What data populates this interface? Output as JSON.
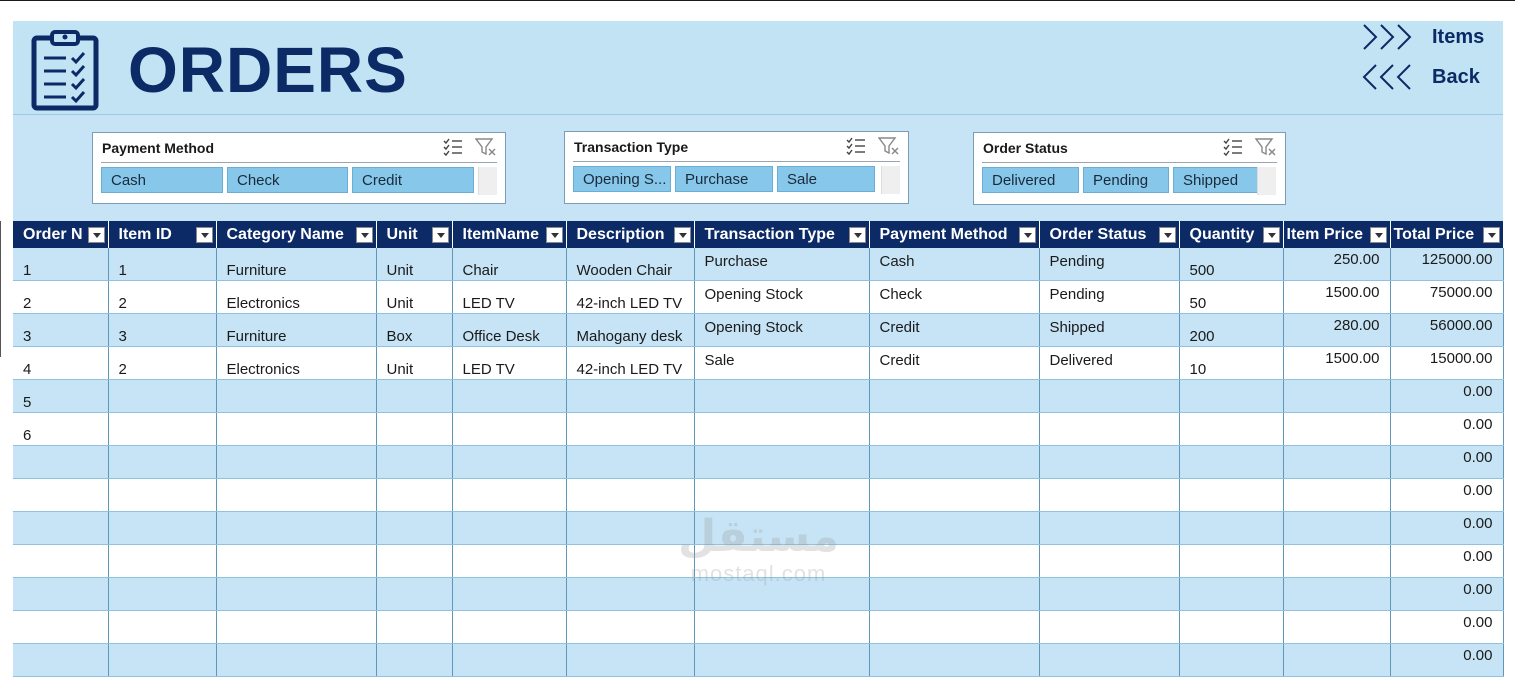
{
  "header": {
    "title": "ORDERS",
    "nav_items": "Items",
    "nav_back": "Back"
  },
  "colors": {
    "navy": "#0b2a66",
    "band_light": "#c6e4f5",
    "slicer_button": "#86c7ea"
  },
  "slicers": {
    "payment": {
      "title": "Payment Method",
      "buttons": [
        "Cash",
        "Check",
        "Credit"
      ]
    },
    "transaction": {
      "title": "Transaction Type",
      "buttons": [
        "Opening S...",
        "Purchase",
        "Sale"
      ]
    },
    "status": {
      "title": "Order Status",
      "buttons": [
        "Delivered",
        "Pending",
        "Shipped"
      ]
    }
  },
  "table": {
    "columns": [
      "Order N",
      "Item ID",
      "Category Name",
      "Unit",
      "ItemName",
      "Description",
      "Transaction Type",
      "Payment Method",
      "Order Status",
      "Quantity",
      "Item Price",
      "Total Price"
    ],
    "rows": [
      [
        "1",
        "1",
        "Furniture",
        "Unit",
        "Chair",
        "Wooden Chair",
        "Purchase",
        "Cash",
        "Pending",
        "500",
        "250.00",
        "125000.00"
      ],
      [
        "2",
        "2",
        "Electronics",
        "Unit",
        "LED TV",
        "42-inch LED TV",
        "Opening Stock",
        "Check",
        "Pending",
        "50",
        "1500.00",
        "75000.00"
      ],
      [
        "3",
        "3",
        "Furniture",
        "Box",
        "Office Desk",
        "Mahogany desk",
        "Opening Stock",
        "Credit",
        "Shipped",
        "200",
        "280.00",
        "56000.00"
      ],
      [
        "4",
        "2",
        "Electronics",
        "Unit",
        "LED TV",
        "42-inch LED TV",
        "Sale",
        "Credit",
        "Delivered",
        "10",
        "1500.00",
        "15000.00"
      ],
      [
        "5",
        "",
        "",
        "",
        "",
        "",
        "",
        "",
        "",
        "",
        "",
        "0.00"
      ],
      [
        "6",
        "",
        "",
        "",
        "",
        "",
        "",
        "",
        "",
        "",
        "",
        "0.00"
      ],
      [
        "",
        "",
        "",
        "",
        "",
        "",
        "",
        "",
        "",
        "",
        "",
        "0.00"
      ],
      [
        "",
        "",
        "",
        "",
        "",
        "",
        "",
        "",
        "",
        "",
        "",
        "0.00"
      ],
      [
        "",
        "",
        "",
        "",
        "",
        "",
        "",
        "",
        "",
        "",
        "",
        "0.00"
      ],
      [
        "",
        "",
        "",
        "",
        "",
        "",
        "",
        "",
        "",
        "",
        "",
        "0.00"
      ],
      [
        "",
        "",
        "",
        "",
        "",
        "",
        "",
        "",
        "",
        "",
        "",
        "0.00"
      ],
      [
        "",
        "",
        "",
        "",
        "",
        "",
        "",
        "",
        "",
        "",
        "",
        "0.00"
      ],
      [
        "",
        "",
        "",
        "",
        "",
        "",
        "",
        "",
        "",
        "",
        "",
        "0.00"
      ]
    ]
  },
  "watermark": {
    "arabic": "مستقل",
    "latin": "mostaql.com"
  }
}
